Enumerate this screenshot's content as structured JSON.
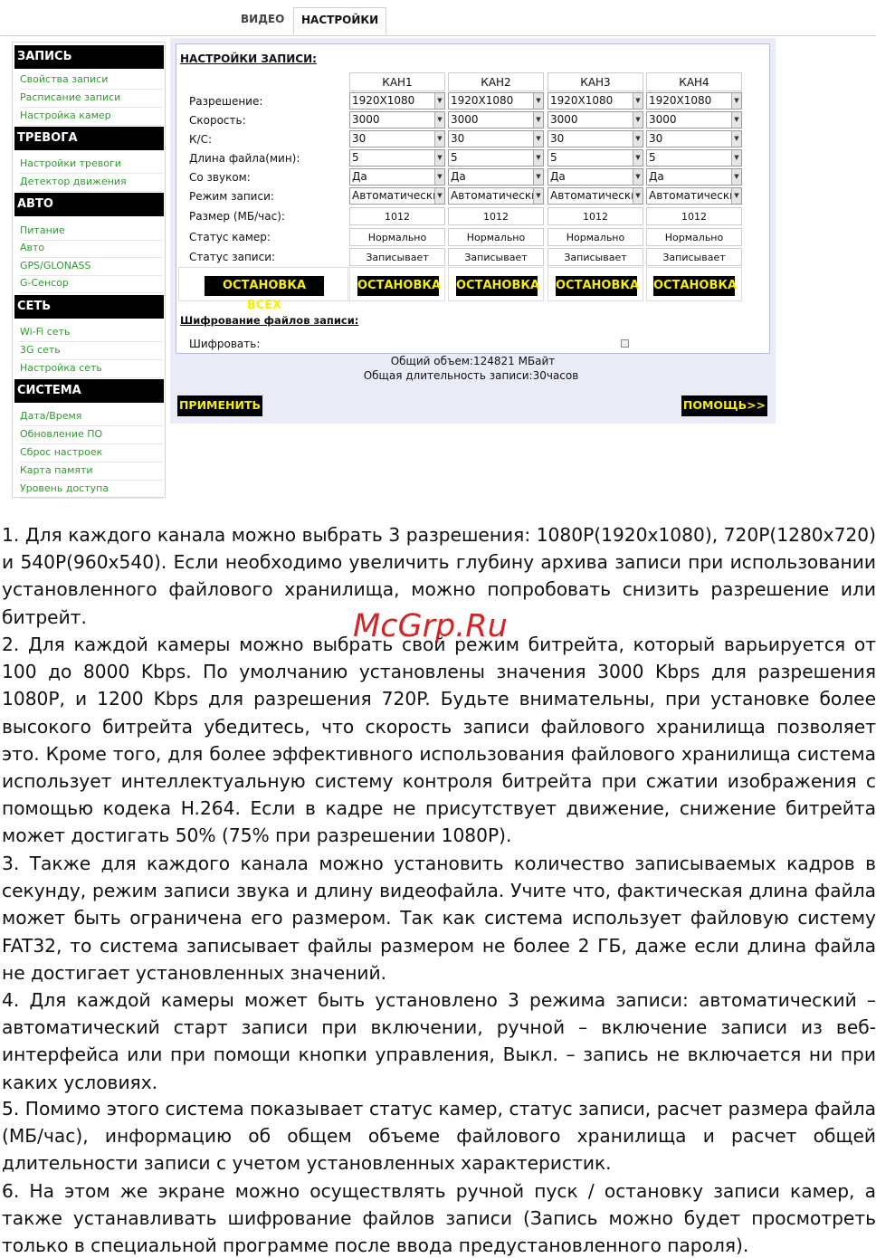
{
  "tabs": [
    "ВИДЕО",
    "НАСТРОЙКИ"
  ],
  "sidebar": {
    "sections": [
      {
        "title": "ЗАПИСЬ",
        "items": [
          "Свойства записи",
          "Расписание записи",
          "Настройка камер"
        ]
      },
      {
        "title": "ТРЕВОГА",
        "items": [
          "Настройки тревоги",
          "Детектор движения"
        ]
      },
      {
        "title": "АВТО",
        "items": [
          "Питание",
          "Авто",
          "GPS/GLONASS",
          "G-Сенсор"
        ]
      },
      {
        "title": "СЕТЬ",
        "items": [
          "Wi-Fi сеть",
          "3G сеть",
          "Настройка сеть"
        ]
      },
      {
        "title": "СИСТЕМА",
        "items": [
          "Дата/Время",
          "Обновление ПО",
          "Сброс настроек",
          "Карта памяти",
          "Уровень доступа"
        ]
      }
    ]
  },
  "record_settings": {
    "title": "НАСТРОЙКИ ЗАПИСИ:",
    "channels": [
      "КАН1",
      "КАН2",
      "КАН3",
      "КАН4"
    ],
    "labels": [
      "Разрешение:",
      "Скорость:",
      "К/С:",
      "Длина файла(мин):",
      "Со звуком:",
      "Режим записи:",
      "Размер (МБ/час):",
      "Статус камер:",
      "Статус записи:"
    ],
    "resolution": [
      "1920X1080",
      "1920X1080",
      "1920X1080",
      "1920X1080"
    ],
    "bitrate": [
      "3000",
      "3000",
      "3000",
      "3000"
    ],
    "fps": [
      "30",
      "30",
      "30",
      "30"
    ],
    "file_length": [
      "5",
      "5",
      "5",
      "5"
    ],
    "audio": [
      "Да",
      "Да",
      "Да",
      "Да"
    ],
    "mode": [
      "Автоматический",
      "Автоматический",
      "Автоматический",
      "Автоматический"
    ],
    "size": [
      "1012",
      "1012",
      "1012",
      "1012"
    ],
    "camera_status": [
      "Нормально",
      "Нормально",
      "Нормально",
      "Нормально"
    ],
    "record_status": [
      "Записывает",
      "Записывает",
      "Записывает",
      "Записывает"
    ],
    "stop_all_label": "ОСТАНОВКА ВСЕХ",
    "stop_labels": [
      "ОСТАНОВКА",
      "ОСТАНОВКА",
      "ОСТАНОВКА",
      "ОСТАНОВКА"
    ]
  },
  "encryption": {
    "title": "Шифрование файлов записи:",
    "label": "Шифровать:",
    "total_volume": "Общий объем:124821 МБайт",
    "total_duration": "Общая длительность записи:30часов"
  },
  "buttons": {
    "apply": "ПРИМЕНИТЬ",
    "help": "ПОМОЩЬ>>"
  },
  "watermark": "McGrp.Ru",
  "paragraphs": [
    "1. Для каждого канала можно выбрать 3 разрешения: 1080P(1920x1080), 720P(1280x720) и 540P(960x540). Если необходимо увеличить глубину архива записи при использовании установленного файлового хранилища, можно попробовать снизить разрешение или битрейт.",
    "2. Для каждой камеры можно выбрать свой режим битрейта, который варьируется от 100 до 8000 Kbps. По умолчанию установлены значения 3000 Kbps для разрешения 1080P, и 1200 Kbps для разрешения 720P. Будьте внимательны, при установке более высокого битрейта убедитесь, что скорость записи файлового хранилища позволяет это. Кроме того, для более эффективного использования файлового хранилища система использует интеллектуальную систему контроля битрейта при сжатии изображения с помощью кодека H.264. Если в кадре не присутствует движение, снижение битрейта может достигать 50% (75% при разрешении 1080P).",
    "3. Также для каждого канала можно установить количество записываемых кадров в секунду, режим записи звука и длину видеофайла. Учите что, фактическая длина файла может быть ограничена его размером. Так как система использует файловую систему FAT32, то система записывает файлы размером не более 2 ГБ, даже если длина файла не достигает установленных значений.",
    "4. Для каждой камеры может быть установлено 3 режима записи: автоматический – автоматический старт записи при включении, ручной – включение записи из веб-интерфейса или при помощи кнопки управления, Выкл. – запись не включается ни при каких условиях.",
    "5. Помимо этого система показывает статус камер, статус записи, расчет размера файла (МБ/час), информацию об общем объеме файлового хранилища и расчет общей длительности записи с учетом установленных характеристик.",
    "6. На этом же экране можно осуществлять ручной пуск / остановку записи камер, а также устанавливать шифрование файлов записи (Запись можно будет просмотреть только в специальной программе после ввода предустановленного пароля)."
  ]
}
